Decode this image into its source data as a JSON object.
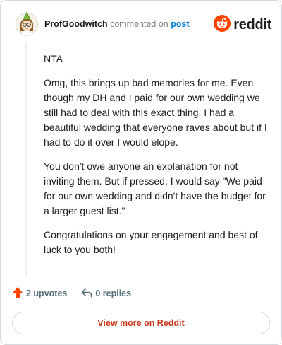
{
  "header": {
    "username": "ProfGoodwitch",
    "commented_on": "commented on",
    "post_link": "post",
    "brand_name": "reddit",
    "avatar_icon": "snoo-avatar-icon",
    "brand_icon": "reddit-snoo-icon"
  },
  "comment": {
    "paragraphs": [
      "NTA",
      "Omg, this brings up bad memories for me. Even though my DH and I paid for our own wedding we still had to deal with this exact thing. I had a beautiful wedding that everyone raves about but if I had to do it over I would elope.",
      "You don't owe anyone an explanation for not inviting them. But if pressed, I would say \"We paid for our own wedding and didn't have the budget for a larger guest list.\"",
      "Congratulations on your engagement and best of luck to you both!"
    ]
  },
  "actions": {
    "upvotes": "2 upvotes",
    "replies": "0 replies",
    "upvote_icon": "upvote-arrow-icon",
    "reply_icon": "reply-arrow-icon"
  },
  "footer": {
    "view_more": "View more on Reddit"
  },
  "colors": {
    "brand_orange": "#ff4500",
    "link_blue": "#0079d3",
    "view_more_text": "#c7361a",
    "border": "#d7dadc"
  }
}
